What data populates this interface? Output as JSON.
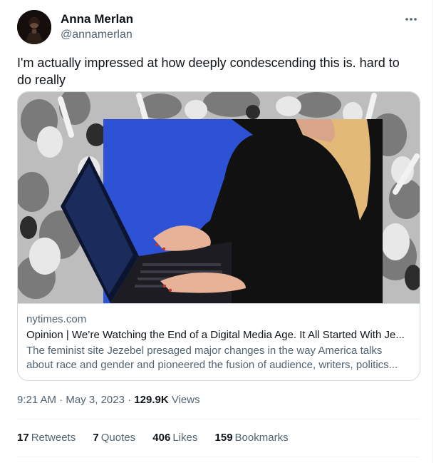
{
  "author": {
    "display_name": "Anna Merlan",
    "handle": "@annamerlan",
    "avatar_icon": "profile-photo"
  },
  "more_icon": "more-horizontal-icon",
  "tweet_text": "I'm actually impressed at how deeply condescending this is. hard to do really",
  "card": {
    "domain": "nytimes.com",
    "title": "Opinion | We’re Watching the End of a Digital Media Age. It All Started With Je...",
    "description": "The feminist site Jezebel presaged major changes in the way America talks about race and gender and pioneered the fusion of audience, writers, politics...",
    "image_accent_color": "#2e52d6"
  },
  "meta": {
    "time": "9:21 AM",
    "separator": "·",
    "date": "May 3, 2023",
    "views_count": "129.9K",
    "views_label": "Views"
  },
  "stats": {
    "retweets_count": "17",
    "retweets_label": "Retweets",
    "quotes_count": "7",
    "quotes_label": "Quotes",
    "likes_count": "406",
    "likes_label": "Likes",
    "bookmarks_count": "159",
    "bookmarks_label": "Bookmarks"
  },
  "colors": {
    "text_primary": "#0f1419",
    "text_secondary": "#536471",
    "border": "#cfd9de",
    "divider": "#eff3f4"
  }
}
